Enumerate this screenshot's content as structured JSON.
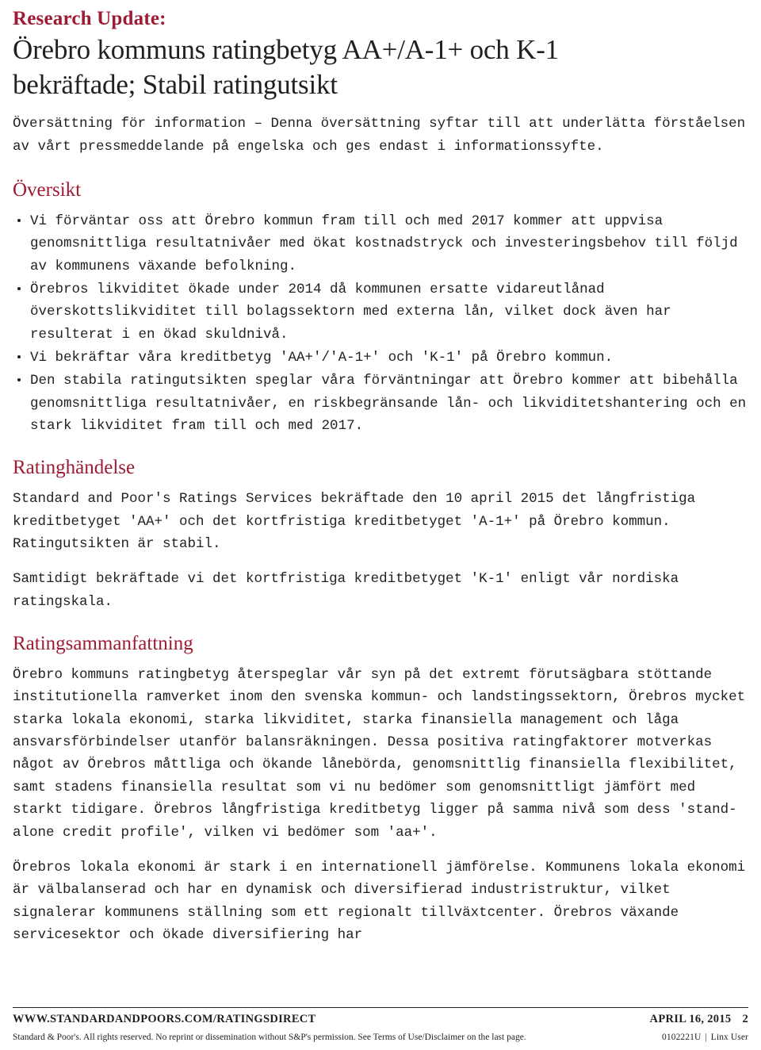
{
  "header": {
    "kicker": "Research Update:",
    "headline_line1": "Örebro kommuns ratingbetyg AA+/A-1+ och K-1",
    "headline_line2": "bekräftade; Stabil ratingutsikt"
  },
  "translation_note": "Översättning för information – Denna översättning syftar till att underlätta förståelsen av vårt pressmeddelande på engelska och ges endast i informationssyfte.",
  "sections": [
    {
      "title": "Översikt",
      "bullets": [
        "Vi förväntar oss att Örebro kommun fram till och med 2017 kommer att uppvisa genomsnittliga resultatnivåer med ökat kostnadstryck och investeringsbehov till följd av kommunens växande befolkning.",
        "Örebros likviditet ökade under 2014 då kommunen ersatte vidareutlånad överskottslikviditet till bolagssektorn med externa lån, vilket dock även har resulterat i en ökad skuldnivå.",
        "Vi bekräftar våra kreditbetyg 'AA+'/'A-1+' och 'K-1' på Örebro kommun.",
        "Den stabila ratingutsikten speglar våra förväntningar att Örebro kommer att bibehålla genomsnittliga resultatnivåer, en riskbegränsande lån- och likviditetshantering och en stark likviditet fram till och med 2017."
      ]
    },
    {
      "title": "Ratinghändelse",
      "paragraphs": [
        "Standard and Poor's Ratings Services bekräftade den 10 april 2015 det långfristiga kreditbetyget 'AA+' och det kortfristiga kreditbetyget 'A-1+' på Örebro kommun. Ratingutsikten är stabil.",
        "Samtidigt bekräftade vi det kortfristiga kreditbetyget 'K-1' enligt vår nordiska ratingskala."
      ]
    },
    {
      "title": "Ratingsammanfattning",
      "paragraphs": [
        "Örebro kommuns ratingbetyg återspeglar vår syn på det extremt förutsägbara stöttande institutionella ramverket inom den svenska kommun- och landstingssektorn, Örebros mycket starka lokala ekonomi, starka likviditet, starka finansiella management och låga ansvarsförbindelser utanför balansräkningen. Dessa positiva ratingfaktorer motverkas något av Örebros måttliga och ökande lånebörda, genomsnittlig finansiella flexibilitet, samt stadens finansiella resultat som vi nu bedömer som genomsnittligt jämfört med starkt tidigare. Örebros långfristiga kreditbetyg ligger på samma nivå som dess 'stand-alone credit profile', vilken vi bedömer som 'aa+'.",
        "Örebros lokala ekonomi är stark i en internationell jämförelse. Kommunens lokala ekonomi är välbalanserad och har en dynamisk och diversifierad industristruktur, vilket signalerar kommunens ställning som ett regionalt tillväxtcenter. Örebros växande servicesektor och ökade diversifiering har"
      ]
    }
  ],
  "footer": {
    "site": "WWW.STANDARDANDPOORS.COM/RATINGSDIRECT",
    "date": "APRIL 16, 2015",
    "page_number": "2",
    "disclaimer": "Standard & Poor's. All rights reserved. No reprint or dissemination without S&P's permission. See Terms of Use/Disclaimer on the last page.",
    "doc_id": "0102221U",
    "user": "Linx User"
  }
}
